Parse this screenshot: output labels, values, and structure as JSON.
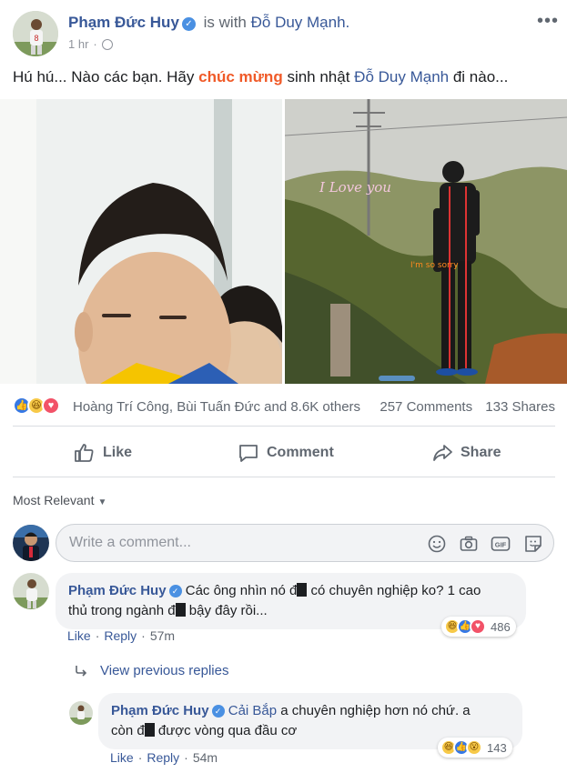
{
  "post": {
    "author": "Phạm Đức Huy",
    "with_text": "is with",
    "tagged_user": "Đỗ Duy Mạnh.",
    "time": "1 hr",
    "more_label": "•••",
    "text_before": "Hú hú... Nào các bạn. Hãy ",
    "text_highlight": "chúc mừng",
    "text_middle": " sinh nhật ",
    "text_mention": "Đỗ Duy Mạnh",
    "text_after": " đi nào...",
    "photo_caption_1": "I Love you",
    "photo_caption_2": "I'm so sorry"
  },
  "stats": {
    "reactions": [
      "like",
      "haha",
      "love"
    ],
    "reactors": "Hoàng Trí Công, Bùi Tuấn Đức and 8.6K others",
    "comments": "257 Comments",
    "shares": "133 Shares"
  },
  "actions": {
    "like": "Like",
    "comment": "Comment",
    "share": "Share"
  },
  "sort_label": "Most Relevant",
  "compose": {
    "placeholder": "Write a comment...",
    "icons": [
      "emoji-icon",
      "camera-icon",
      "gif-icon",
      "sticker-icon"
    ],
    "gif": "GIF"
  },
  "comments": [
    {
      "author": "Phạm Đức Huy",
      "line1_a": "Các ông nhìn nó đ",
      "line1_b": " có chuyên nghiệp ko? 1 cao",
      "line2_a": "thủ trong ngành đ",
      "line2_b": " bậy đây rồi...",
      "like": "Like",
      "reply": "Reply",
      "time": "57m",
      "reactions": [
        "haha",
        "like",
        "love"
      ],
      "reaction_count": "486"
    }
  ],
  "view_previous": "View previous replies",
  "reply": {
    "author": "Phạm Đức Huy",
    "mention": "Cải Bắp",
    "line1": " a chuyên nghiệp hơn nó chứ. a",
    "line2_a": "còn đ",
    "line2_b": " được vòng qua đầu cơ",
    "like": "Like",
    "reply": "Reply",
    "time": "54m",
    "reactions": [
      "haha",
      "like",
      "wow"
    ],
    "reaction_count": "143"
  },
  "colors": {
    "link": "#385898",
    "highlight": "#f05a28",
    "like_blue": "#3578e5",
    "love_red": "#f25268",
    "haha_yellow": "#f7c948"
  }
}
